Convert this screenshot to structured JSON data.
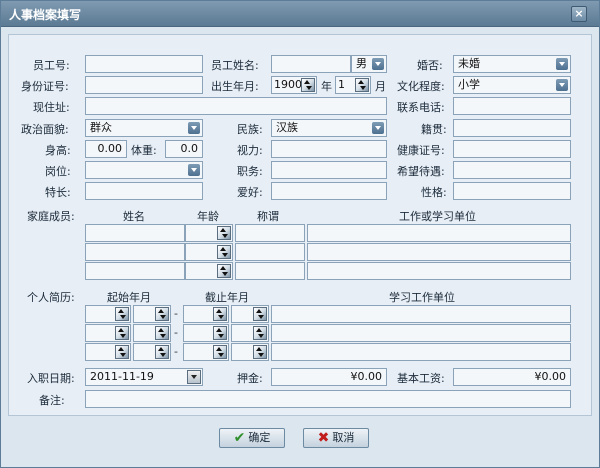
{
  "window": {
    "title": "人事档案填写",
    "close_glyph": "×"
  },
  "fields": {
    "emp_no_label": "员工号:",
    "name_label": "员工姓名:",
    "gender_value": "男",
    "marital_label": "婚否:",
    "marital_value": "未婚",
    "id_label": "身份证号:",
    "birth_label": "出生年月:",
    "birth_year": "1900",
    "year_unit": "年",
    "birth_month": "1",
    "month_unit": "月",
    "edu_label": "文化程度:",
    "edu_value": "小学",
    "address_label": "现住址:",
    "phone_label": "联系电话:",
    "politics_label": "政治面貌:",
    "politics_value": "群众",
    "nation_label": "民族:",
    "nation_value": "汉族",
    "origin_label": "籍贯:",
    "height_label": "身高:",
    "height_value": "0.00",
    "weight_label": "体重:",
    "weight_value": "0.0",
    "vision_label": "视力:",
    "health_label": "健康证号:",
    "post_label": "岗位:",
    "duty_label": "职务:",
    "salary_expect_label": "希望待遇:",
    "specialty_label": "特长:",
    "hobby_label": "爱好:",
    "character_label": "性格:"
  },
  "family": {
    "section_label": "家庭成员:",
    "headers": {
      "name": "姓名",
      "age": "年龄",
      "relation": "称谓",
      "unit": "工作或学习单位"
    }
  },
  "resume": {
    "section_label": "个人简历:",
    "headers": {
      "start": "起始年月",
      "end": "截止年月",
      "unit": "学习工作单位"
    }
  },
  "bottom": {
    "hire_label": "入职日期:",
    "hire_value": "2011-11-19",
    "deposit_label": "押金:",
    "deposit_value": "¥0.00",
    "base_salary_label": "基本工资:",
    "base_salary_value": "¥0.00",
    "remark_label": "备注:"
  },
  "buttons": {
    "ok": "确定",
    "cancel": "取消",
    "ok_glyph": "✔",
    "cancel_glyph": "✖"
  }
}
